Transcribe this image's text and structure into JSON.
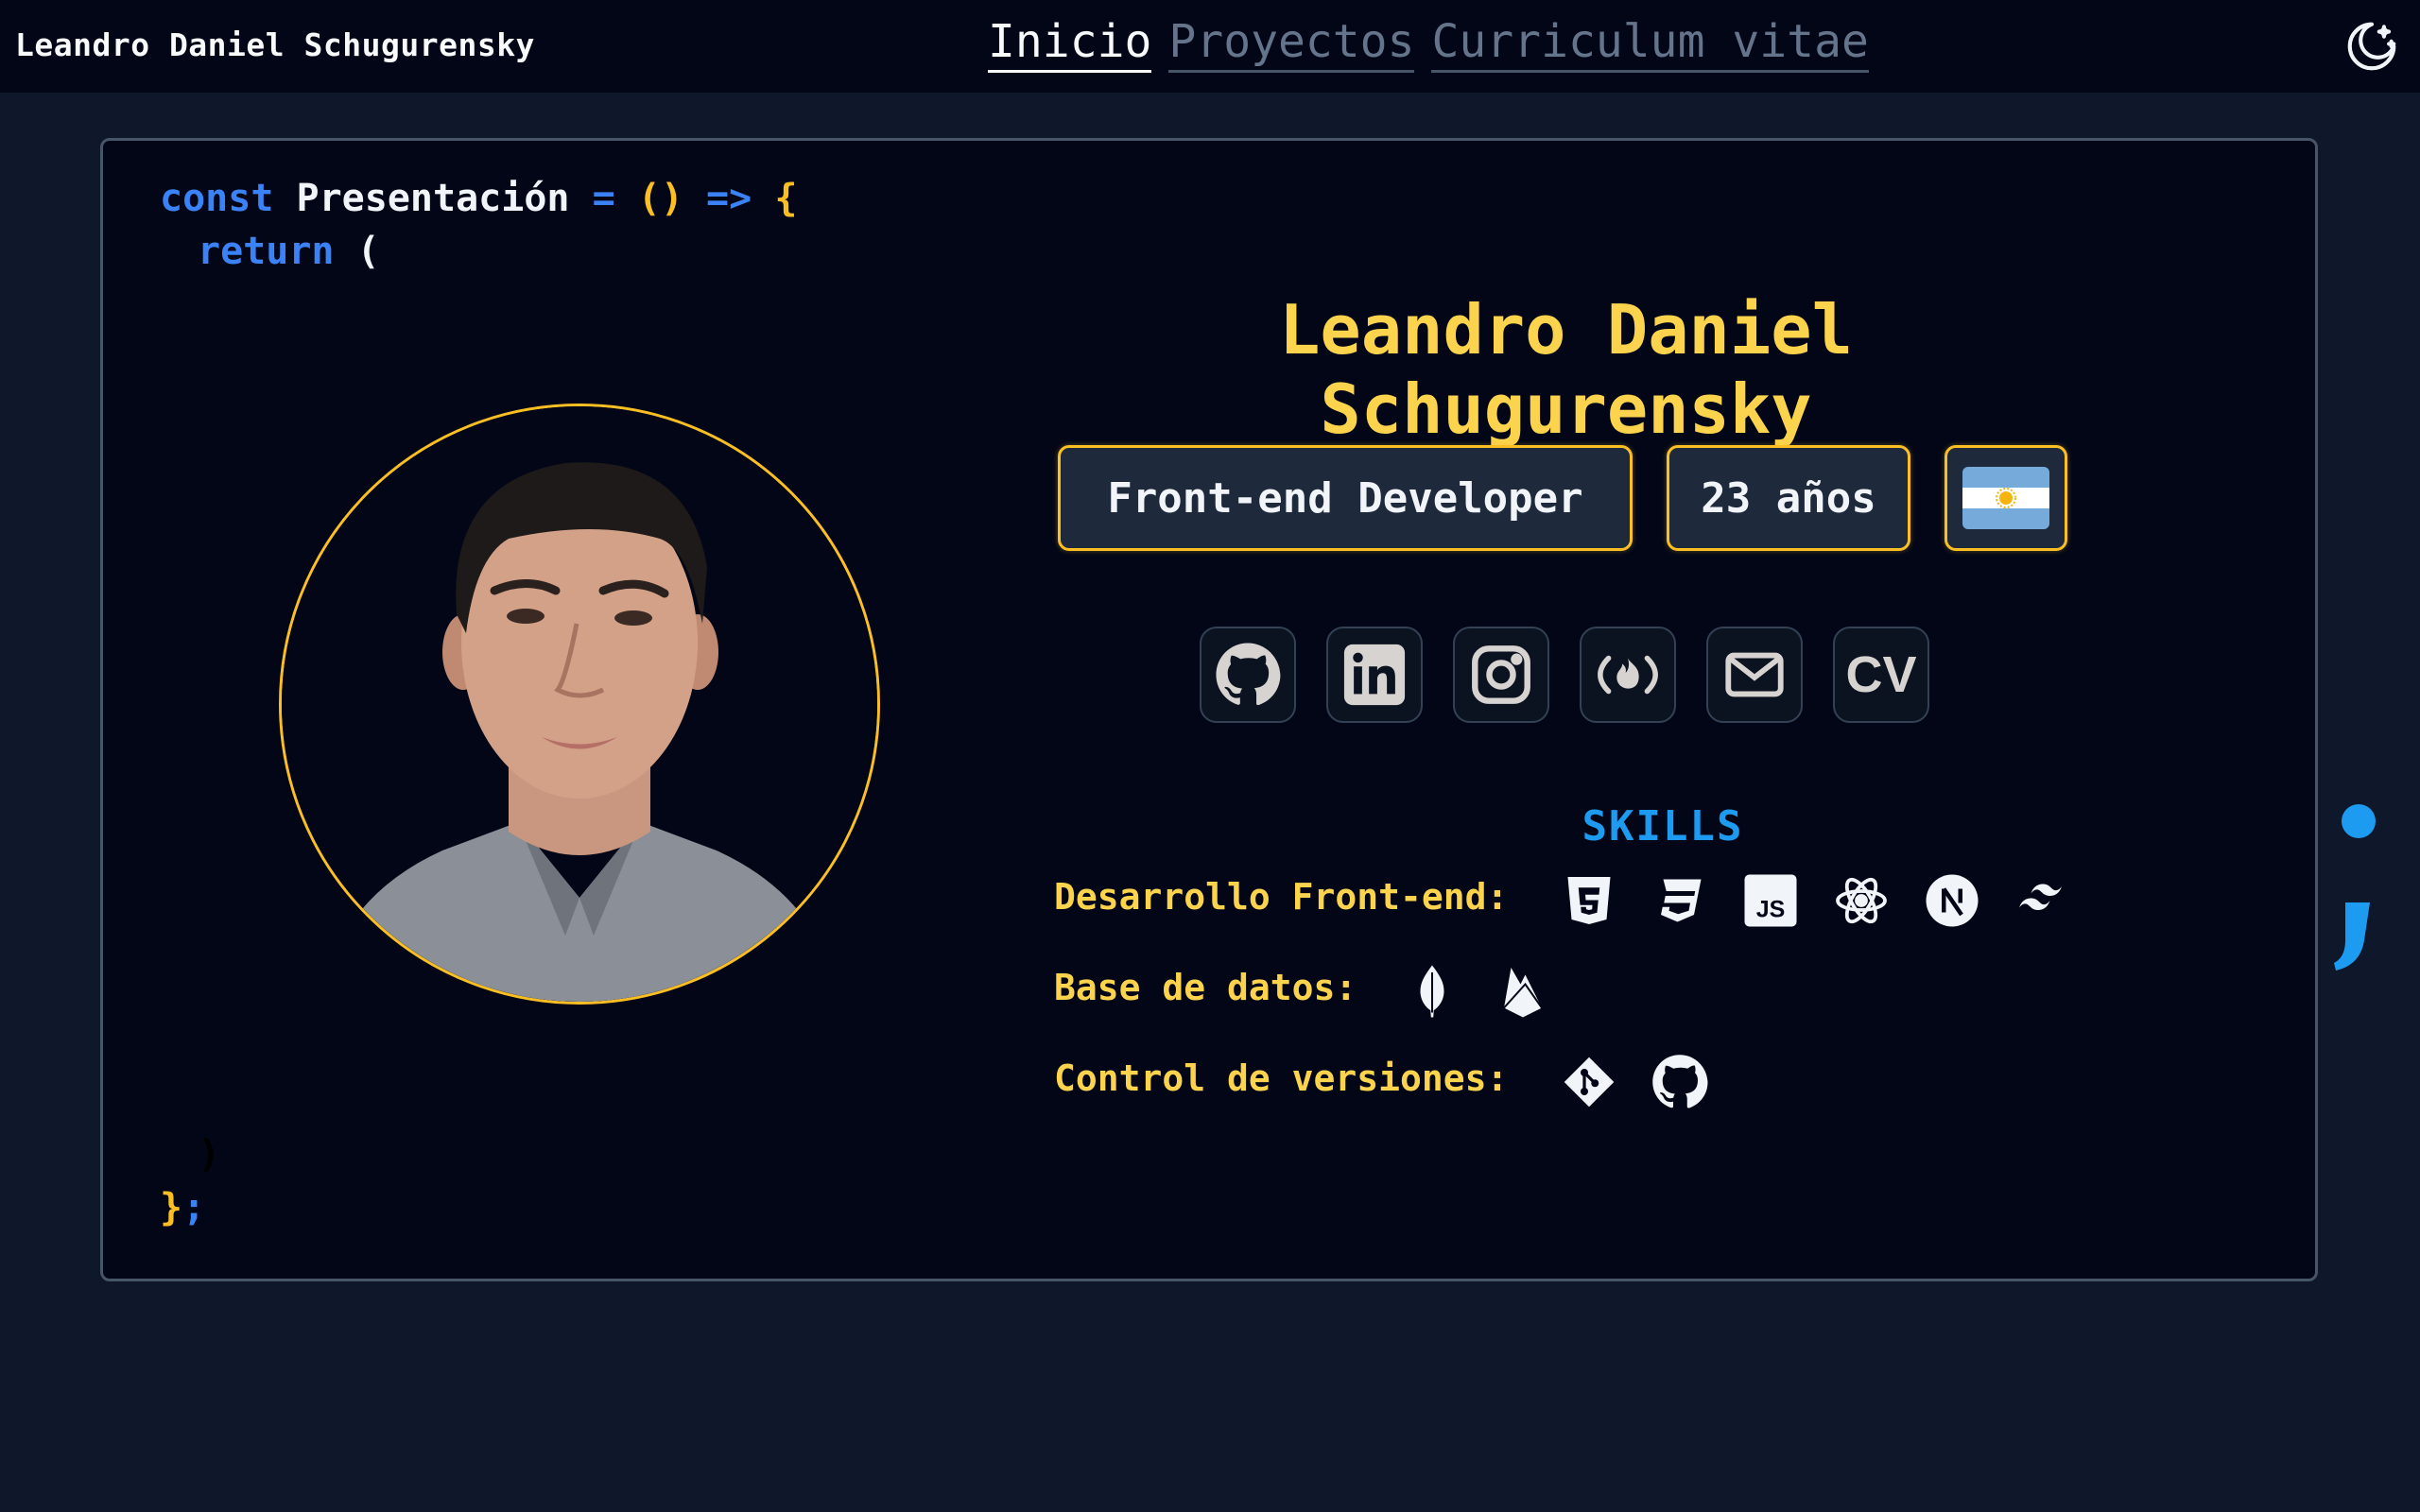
{
  "navbar": {
    "brand": "Leandro Daniel Schugurensky",
    "links": [
      {
        "label": "Inicio",
        "active": true
      },
      {
        "label": "Proyectos",
        "active": false
      },
      {
        "label": "Curriculum vitae",
        "active": false
      }
    ],
    "theme_icon": "moon-stars-icon"
  },
  "code": {
    "line1_kw": "const",
    "line1_name": "Presentación",
    "line1_eq": "=",
    "line1_parens": "()",
    "line1_arrow": "=>",
    "line1_brace": "{",
    "line2_kw": "return",
    "line2_paren": "(",
    "close_paren": ")",
    "close_brace": "}",
    "close_semi": ";"
  },
  "profile": {
    "name": "Leandro Daniel Schugurensky",
    "role": "Front-end Developer",
    "age": "23 años",
    "country_flag": "argentina-flag-icon"
  },
  "social_links": [
    {
      "icon": "github-icon"
    },
    {
      "icon": "linkedin-icon"
    },
    {
      "icon": "instagram-icon"
    },
    {
      "icon": "freecodecamp-icon"
    },
    {
      "icon": "mail-icon"
    },
    {
      "icon": "cv-icon",
      "label": "CV"
    }
  ],
  "skills": {
    "title": "SKILLS",
    "groups": [
      {
        "label": "Desarrollo Front-end:",
        "icons": [
          "html5-icon",
          "css3-icon",
          "javascript-icon",
          "react-icon",
          "nextjs-icon",
          "tailwind-icon"
        ]
      },
      {
        "label": "Base de datos:",
        "icons": [
          "mongodb-icon",
          "firebase-icon"
        ]
      },
      {
        "label": "Control de versiones:",
        "icons": [
          "git-icon",
          "github-icon"
        ]
      }
    ]
  },
  "colors": {
    "accent": "#fcd34d",
    "keyword": "#3b82f6",
    "skills_title": "#1d9bf0",
    "background": "#0f172a",
    "card": "#020617"
  }
}
